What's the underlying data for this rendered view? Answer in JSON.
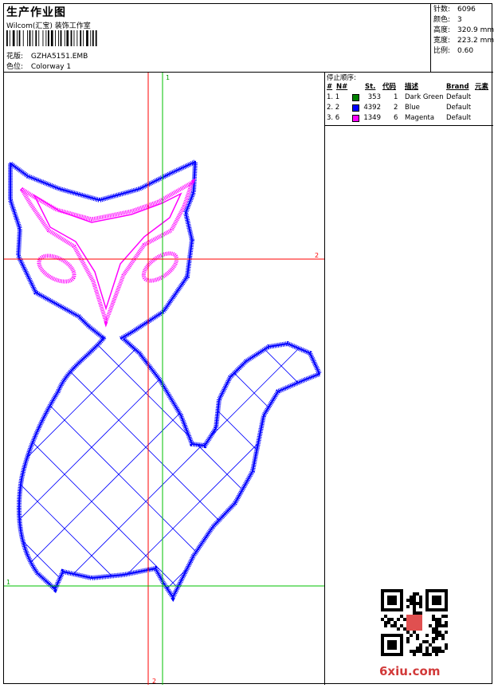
{
  "header": {
    "title": "生产作业图",
    "company": "Wilcom(汇宝) 装饰工作室",
    "design_label": "花版:",
    "design_value": "GZHA5151.EMB",
    "colorway_label": "色位:",
    "colorway_value": "Colorway 1"
  },
  "stats": [
    {
      "label": "针数:",
      "value": "6096"
    },
    {
      "label": "颜色:",
      "value": "3"
    },
    {
      "label": "高度:",
      "value": "320.9 mm"
    },
    {
      "label": "宽度:",
      "value": "223.2 mm"
    },
    {
      "label": "比例:",
      "value": "0.60"
    }
  ],
  "stop_sequence": {
    "title": "停止顺序:",
    "headers": {
      "hash": "#",
      "n": "N#",
      "st": "St.",
      "code": "代码",
      "desc": "描述",
      "brand": "Brand",
      "elem": "元素"
    },
    "rows": [
      {
        "idx": "1. 1",
        "color": "#008000",
        "st": "353",
        "code": "1",
        "desc": "Dark Green",
        "brand": "Default"
      },
      {
        "idx": "2. 2",
        "color": "#0000ff",
        "st": "4392",
        "code": "2",
        "desc": "Blue",
        "brand": "Default"
      },
      {
        "idx": "3. 6",
        "color": "#ff00ff",
        "st": "1349",
        "code": "6",
        "desc": "Magenta",
        "brand": "Default"
      }
    ]
  },
  "guides": {
    "v_label_top": "1",
    "h_label_right": "2",
    "h_label_left": "1",
    "v_label_bottom": "2"
  },
  "watermark": "6xiu.com",
  "colors": {
    "outline": "#0000ff",
    "mask": "#ff00ff",
    "guide_red": "#ff0000",
    "guide_green": "#00c000"
  }
}
